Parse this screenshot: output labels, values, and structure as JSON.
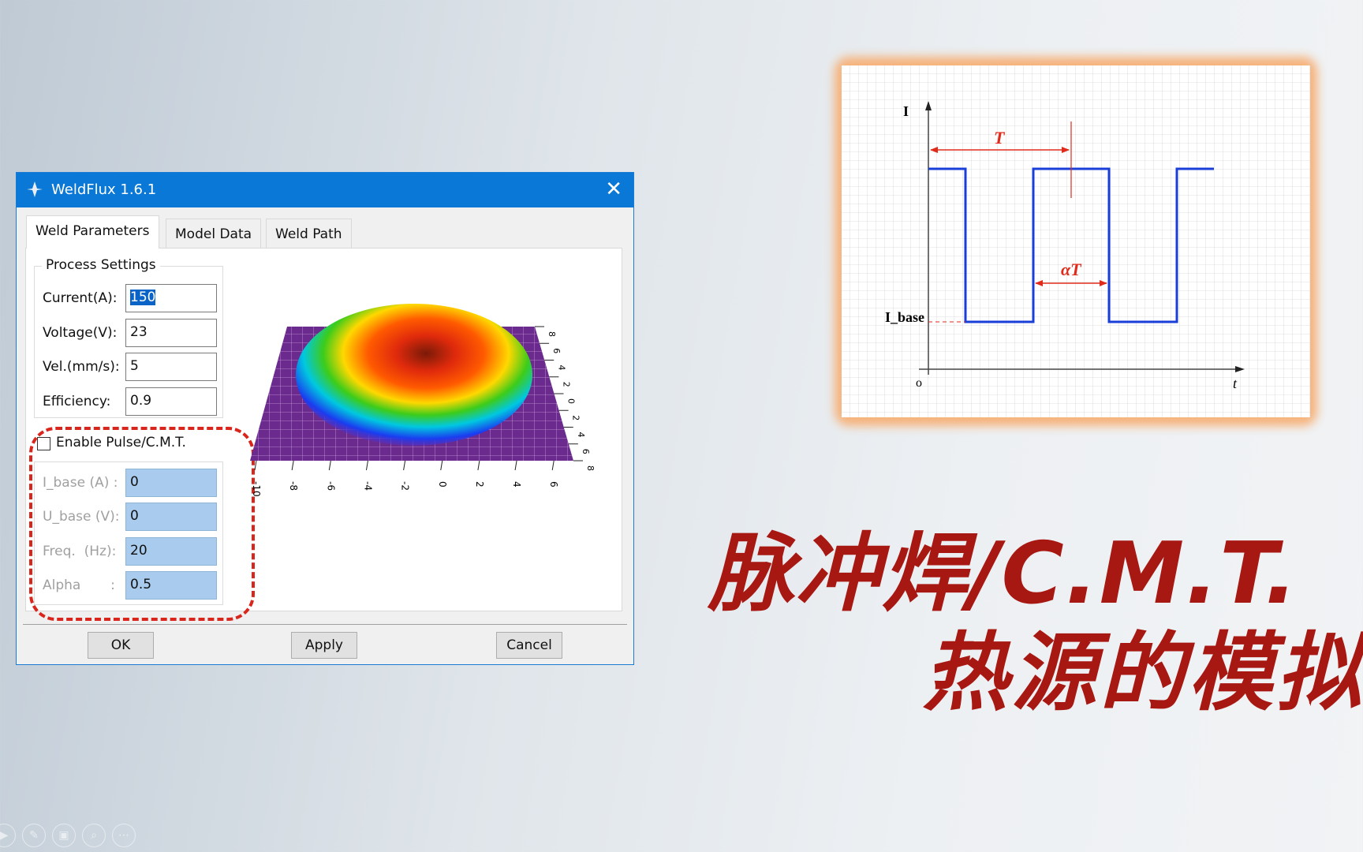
{
  "dialog": {
    "title": "WeldFlux 1.6.1",
    "tabs": [
      {
        "label": "Weld Parameters",
        "active": true
      },
      {
        "label": "Model Data"
      },
      {
        "label": "Weld Path"
      }
    ],
    "process_settings": {
      "group_label": "Process Settings",
      "fields": [
        {
          "label": "Current(A):",
          "value": "150",
          "selected": true
        },
        {
          "label": "Voltage(V):",
          "value": "23"
        },
        {
          "label": "Vel.(mm/s):",
          "value": "5"
        },
        {
          "label": "Efficiency:",
          "value": "0.9"
        }
      ]
    },
    "pulse": {
      "checkbox_label": "Enable Pulse/C.M.T.",
      "checked": false,
      "fields": [
        {
          "label": "I_base (A) :",
          "value": "0"
        },
        {
          "label": "U_base (V):",
          "value": "0"
        },
        {
          "label": "Freq.  (Hz):",
          "value": "20"
        },
        {
          "label": "Alpha       :",
          "value": "0.5"
        }
      ]
    },
    "plot": {
      "x_ticks": [
        "-10",
        "-8",
        "-6",
        "-4",
        "-2",
        "0",
        "2",
        "4",
        "6"
      ],
      "y_ticks": [
        "8",
        "6",
        "4",
        "2",
        "0",
        "2",
        "4",
        "6",
        "8"
      ]
    },
    "buttons": {
      "ok": "OK",
      "apply": "Apply",
      "cancel": "Cancel"
    }
  },
  "waveform": {
    "y_label": "I",
    "x_label": "t",
    "origin_label": "o",
    "period_label": "T",
    "duty_label": "αT",
    "base_label": "I_base",
    "line_color": "#1a3fd8",
    "annotation_color": "#e02a1a"
  },
  "headline": {
    "line1": "脉冲焊/C.M.T.",
    "line2": "热源的模拟",
    "color": "#a81812"
  },
  "player_controls": [
    "play-icon",
    "pen-icon",
    "window-icon",
    "zoom-icon",
    "more-icon"
  ]
}
